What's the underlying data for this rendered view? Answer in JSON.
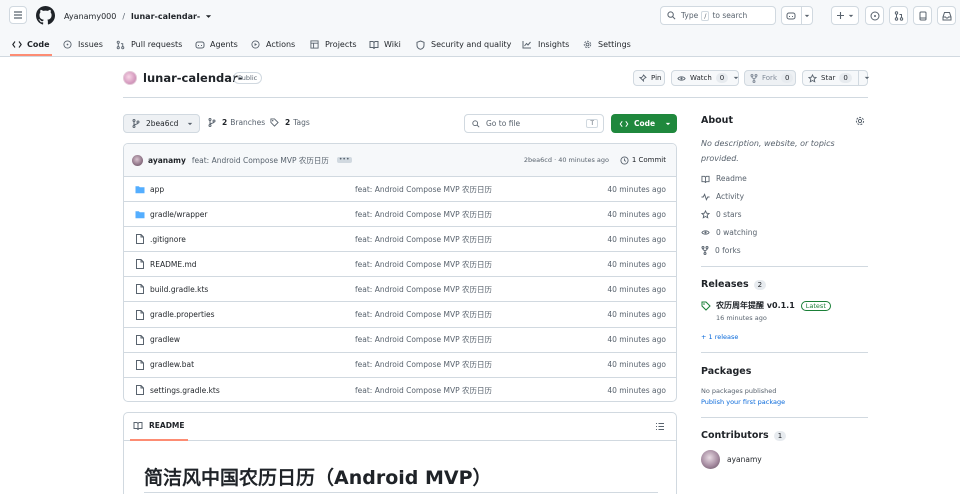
{
  "header": {
    "owner": "Ayanamy000",
    "slash": "/",
    "repo": "lunar-calendar-",
    "search_placeholder": "Type / to search",
    "search_prefix": "Type",
    "search_key": "/",
    "search_suffix": "to search"
  },
  "nav": {
    "tabs": [
      "Code",
      "Issues",
      "Pull requests",
      "Agents",
      "Actions",
      "Projects",
      "Wiki",
      "Security and quality",
      "Insights",
      "Settings"
    ]
  },
  "repo_head": {
    "name": "lunar-calendar-",
    "visibility": "Public",
    "pin": "Pin",
    "watch": "Watch",
    "watch_count": "0",
    "fork": "Fork",
    "fork_count": "0",
    "star": "Star",
    "star_count": "0"
  },
  "toolbar": {
    "branch": "2bea6cd",
    "branches_count": "2",
    "branches_label": "Branches",
    "tags_count": "2",
    "tags_label": "Tags",
    "goto_placeholder": "Go to file",
    "goto_key": "T",
    "code_button": "Code"
  },
  "commit": {
    "author": "ayanamy",
    "message": "feat: Android Compose MVP 农历日历",
    "hash_time": "2bea6cd · 40 minutes ago",
    "count": "1 Commit"
  },
  "files": [
    {
      "name": "app",
      "type": "folder",
      "message": "feat: Android Compose MVP 农历日历",
      "time": "40 minutes ago"
    },
    {
      "name": "gradle/wrapper",
      "type": "folder",
      "message": "feat: Android Compose MVP 农历日历",
      "time": "40 minutes ago"
    },
    {
      "name": ".gitignore",
      "type": "file",
      "message": "feat: Android Compose MVP 农历日历",
      "time": "40 minutes ago"
    },
    {
      "name": "README.md",
      "type": "file",
      "message": "feat: Android Compose MVP 农历日历",
      "time": "40 minutes ago"
    },
    {
      "name": "build.gradle.kts",
      "type": "file",
      "message": "feat: Android Compose MVP 农历日历",
      "time": "40 minutes ago"
    },
    {
      "name": "gradle.properties",
      "type": "file",
      "message": "feat: Android Compose MVP 农历日历",
      "time": "40 minutes ago"
    },
    {
      "name": "gradlew",
      "type": "file",
      "message": "feat: Android Compose MVP 农历日历",
      "time": "40 minutes ago"
    },
    {
      "name": "gradlew.bat",
      "type": "file",
      "message": "feat: Android Compose MVP 农历日历",
      "time": "40 minutes ago"
    },
    {
      "name": "settings.gradle.kts",
      "type": "file",
      "message": "feat: Android Compose MVP 农历日历",
      "time": "40 minutes ago"
    }
  ],
  "readme": {
    "tab": "README",
    "heading": "简洁风中国农历日历（Android MVP）"
  },
  "about": {
    "title": "About",
    "description": "No description, website, or topics provided.",
    "items": [
      "Readme",
      "Activity",
      "0 stars",
      "0 watching",
      "0 forks"
    ]
  },
  "releases": {
    "title": "Releases",
    "count": "2",
    "release_name": "农历周年提醒 v0.1.1",
    "latest": "Latest",
    "time": "16 minutes ago",
    "more": "+ 1 release"
  },
  "packages": {
    "title": "Packages",
    "none": "No packages published",
    "link": "Publish your first package"
  },
  "contributors": {
    "title": "Contributors",
    "count": "1",
    "name": "ayanamy"
  },
  "colors": {
    "accent": "#0969da",
    "code_button": "#1f883d",
    "tab_underline": "#fd8c73",
    "folder": "#54aeff"
  }
}
